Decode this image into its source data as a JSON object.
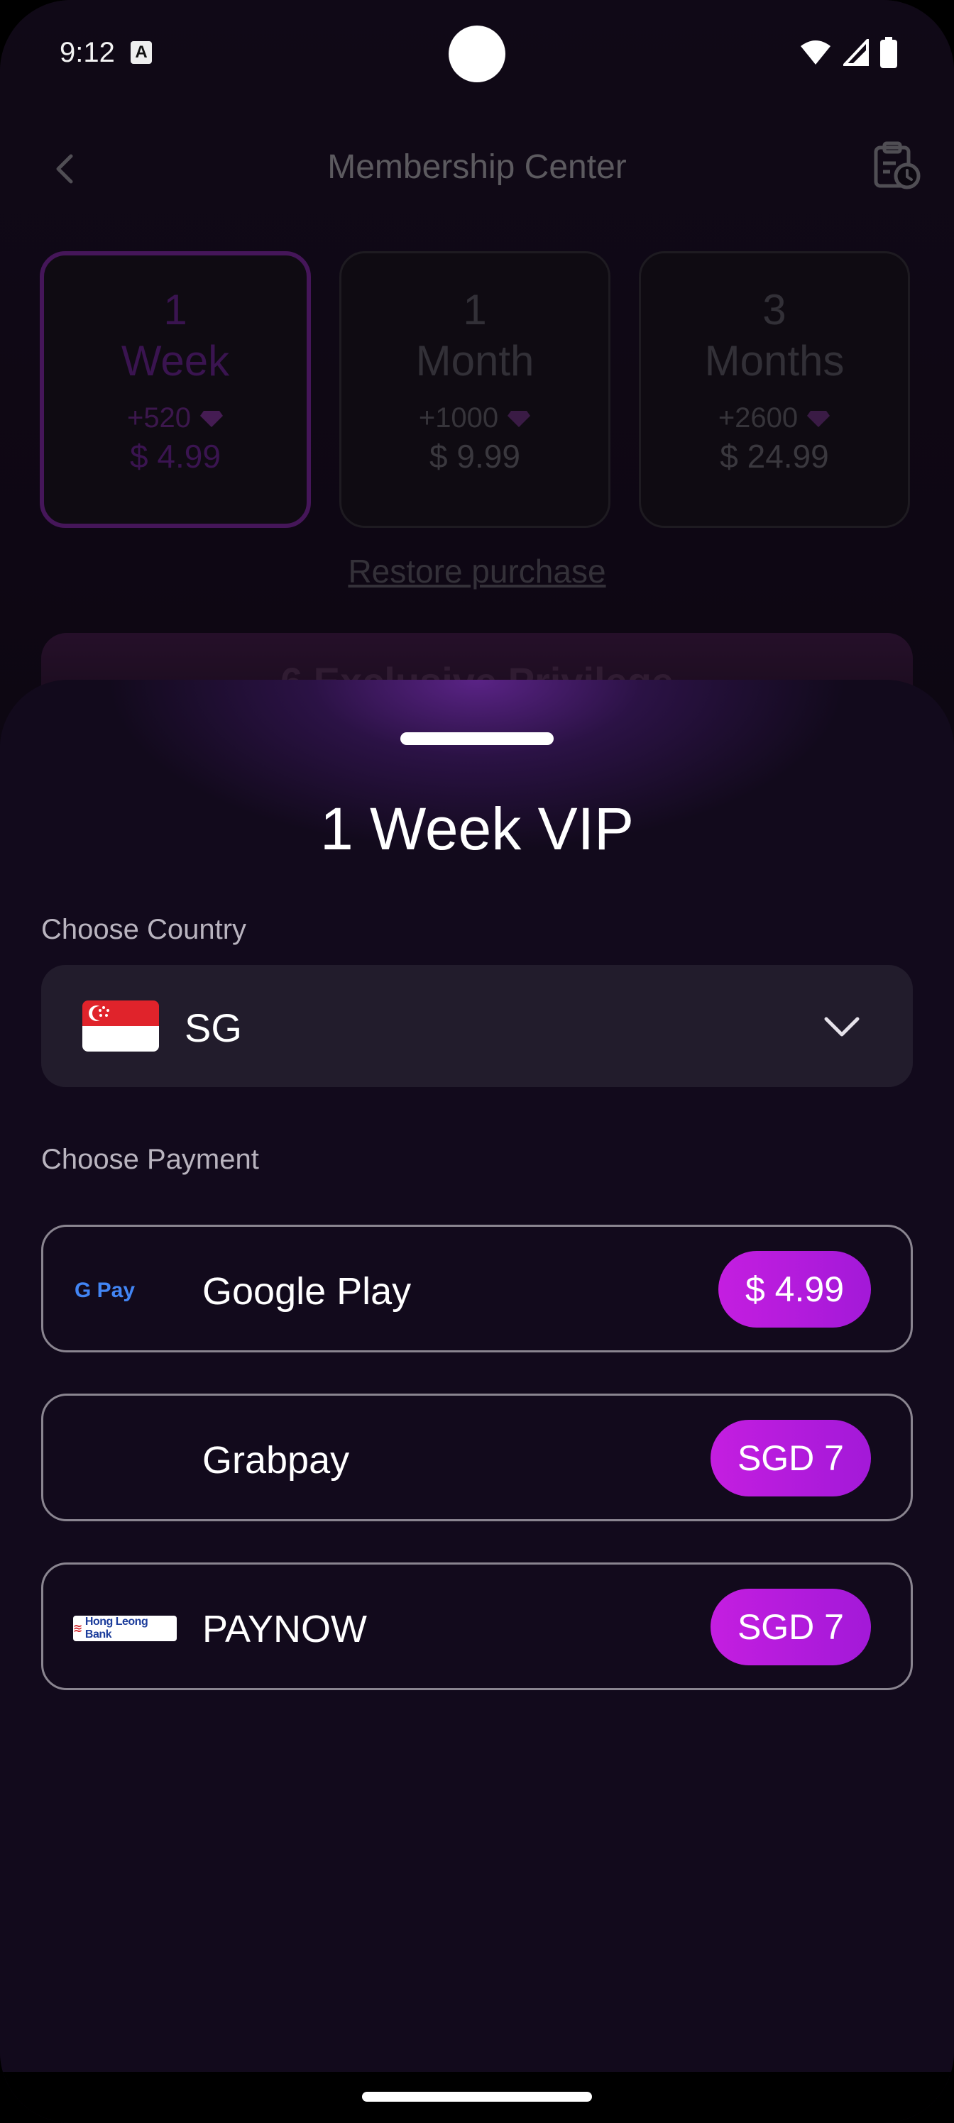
{
  "status_bar": {
    "time": "9:12",
    "notification_glyph": "A"
  },
  "header": {
    "title": "Membership Center"
  },
  "plans": [
    {
      "count": "1",
      "unit": "Week",
      "bonus": "+520",
      "price": "$ 4.99",
      "selected": true
    },
    {
      "count": "1",
      "unit": "Month",
      "bonus": "+1000",
      "price": "$ 9.99",
      "selected": false
    },
    {
      "count": "3",
      "unit": "Months",
      "bonus": "+2600",
      "price": "$ 24.99",
      "selected": false
    }
  ],
  "restore_label": "Restore purchase",
  "privilege_title": "6 Exclusive Privilege",
  "sheet": {
    "title": "1 Week VIP",
    "country_label": "Choose Country",
    "country": {
      "code": "SG"
    },
    "payment_label": "Choose Payment",
    "payments": [
      {
        "logo": "G Pay",
        "name": "Google Play",
        "price": "$ 4.99"
      },
      {
        "logo": "",
        "name": "Grabpay",
        "price": "SGD 7"
      },
      {
        "logo": "Hong Leong Bank",
        "name": "PAYNOW",
        "price": "SGD 7"
      }
    ]
  },
  "colors": {
    "accent": "#c41ee0",
    "selected_border": "#6b2389",
    "sheet_bg": "#120a1c"
  }
}
